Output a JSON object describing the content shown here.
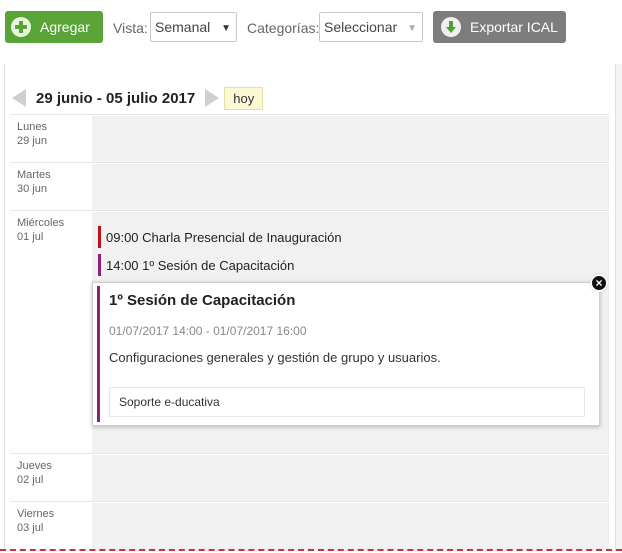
{
  "toolbar": {
    "add_label": "Agregar",
    "vista_label": "Vista:",
    "vista_value": "Semanal",
    "categorias_label": "Categorías:",
    "categorias_value": "Seleccionar",
    "export_label": "Exportar ICAL"
  },
  "nav": {
    "range": "29 junio - 05 julio 2017",
    "today": "hoy"
  },
  "days": [
    {
      "name": "Lunes",
      "date": "29 jun"
    },
    {
      "name": "Martes",
      "date": "30 jun"
    },
    {
      "name": "Miércoles",
      "date": "01 jul"
    },
    {
      "name": "Jueves",
      "date": "02 jul"
    },
    {
      "name": "Viernes",
      "date": "03 jul"
    }
  ],
  "events": [
    {
      "time": "09:00",
      "title": "Charla Presencial de Inauguración",
      "color": "#c0121b"
    },
    {
      "time": "14:00",
      "title": "1º Sesión de Capacitación",
      "color": "#8e1f7d"
    }
  ],
  "popup": {
    "title": "1º Sesión de Capacitación",
    "dates": "01/07/2017 14:00 - 01/07/2017 16:00",
    "description": "Configuraciones generales y gestión de grupo y usuarios.",
    "category": "Soporte e-ducativa",
    "close": "×",
    "accent": "#8e1f7d"
  },
  "icons": {
    "add": "plus-icon",
    "export": "download-icon",
    "prev": "triangle-left-icon",
    "next": "triangle-right-icon",
    "close": "close-icon"
  },
  "colors": {
    "add_button": "#5aa437",
    "export_button": "#7d7d7d",
    "today_bg": "#fdf8d4"
  }
}
